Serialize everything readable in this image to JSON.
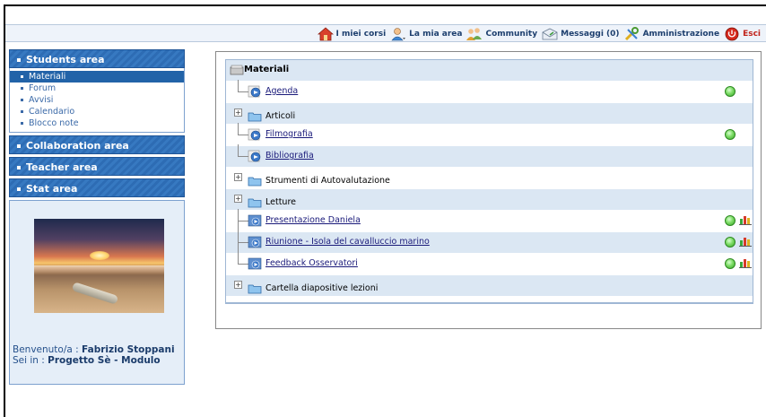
{
  "topnav": [
    {
      "id": "courses",
      "label": "I miei corsi",
      "icon": "home-icon"
    },
    {
      "id": "myarea",
      "label": "La mia area",
      "icon": "user-icon"
    },
    {
      "id": "community",
      "label": "Community",
      "icon": "community-icon"
    },
    {
      "id": "messages",
      "label": "Messaggi (0)",
      "icon": "mail-icon"
    },
    {
      "id": "admin",
      "label": "Amministrazione",
      "icon": "tools-icon"
    },
    {
      "id": "exit",
      "label": "Esci",
      "icon": "power-icon"
    }
  ],
  "sidebar": {
    "students_title": "Students area",
    "students_items": [
      "Materiali",
      "Forum",
      "Avvisi",
      "Calendario",
      "Blocco note"
    ],
    "active_item": "Materiali",
    "collab_title": "Collaboration area",
    "teacher_title": "Teacher area",
    "stat_title": "Stat area",
    "welcome_prefix": "Benvenuto/a :",
    "user_name": "Fabrizio Stoppani",
    "course_prefix": "Sei in :",
    "course_name": "Progetto Sè - Modulo"
  },
  "tree": {
    "root_label": "Materiali",
    "rows": [
      {
        "label": "Agenda",
        "type": "resource",
        "status": true,
        "stats": false
      },
      {
        "label": "Articoli",
        "type": "folder"
      },
      {
        "label": "Filmografia",
        "type": "resource",
        "status": true,
        "stats": false
      },
      {
        "label": "Bibliografia",
        "type": "resource",
        "status": false,
        "stats": false
      },
      {
        "label": "Strumenti di Autovalutazione",
        "type": "folder"
      },
      {
        "label": "Letture",
        "type": "folder"
      },
      {
        "label": "Presentazione Daniela",
        "type": "resource",
        "status": true,
        "stats": true
      },
      {
        "label": "Riunione - Isola del cavalluccio marino",
        "type": "resource",
        "status": true,
        "stats": true
      },
      {
        "label": "Feedback Osservatori",
        "type": "resource",
        "status": true,
        "stats": true
      },
      {
        "label": "Cartella diapositive lezioni",
        "type": "folder"
      }
    ]
  },
  "colors": {
    "sidebar_header": "#2d6cb4",
    "active_item": "#2263a8",
    "row_alt": "#dbe7f3",
    "status_green": "#7ddc66"
  }
}
